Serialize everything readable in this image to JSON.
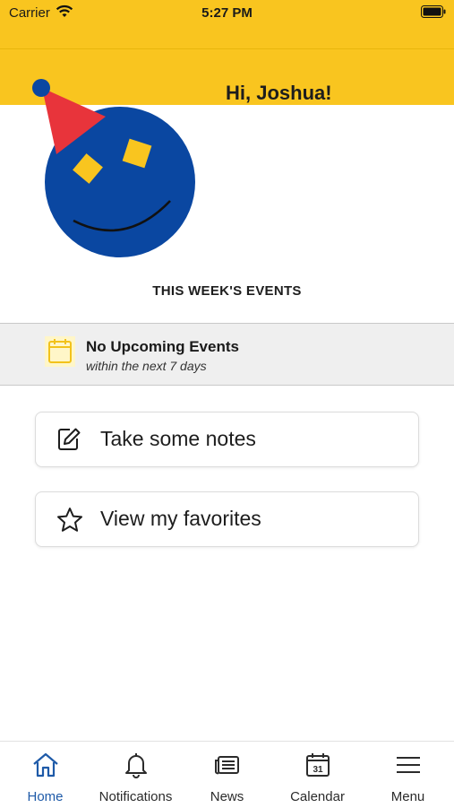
{
  "status_bar": {
    "carrier": "Carrier",
    "time": "5:27 PM"
  },
  "header": {
    "greeting": "Hi, Joshua!"
  },
  "events": {
    "section_title": "THIS WEEK'S EVENTS",
    "empty_title": "No Upcoming Events",
    "empty_subtitle": "within the next 7 days"
  },
  "actions": [
    {
      "label": "Take some notes",
      "icon": "edit-icon"
    },
    {
      "label": "View my favorites",
      "icon": "star-icon"
    }
  ],
  "tabs": [
    {
      "label": "Home",
      "icon": "home-icon",
      "active": true
    },
    {
      "label": "Notifications",
      "icon": "bell-icon",
      "active": false
    },
    {
      "label": "News",
      "icon": "newspaper-icon",
      "active": false
    },
    {
      "label": "Calendar",
      "icon": "calendar-icon",
      "active": false
    },
    {
      "label": "Menu",
      "icon": "menu-icon",
      "active": false
    }
  ],
  "calendar_icon_day": "31",
  "colors": {
    "brand_yellow": "#f9c51f",
    "brand_blue": "#0a47a1",
    "accent_red": "#e8343b",
    "active_tab": "#1e5aa8"
  }
}
